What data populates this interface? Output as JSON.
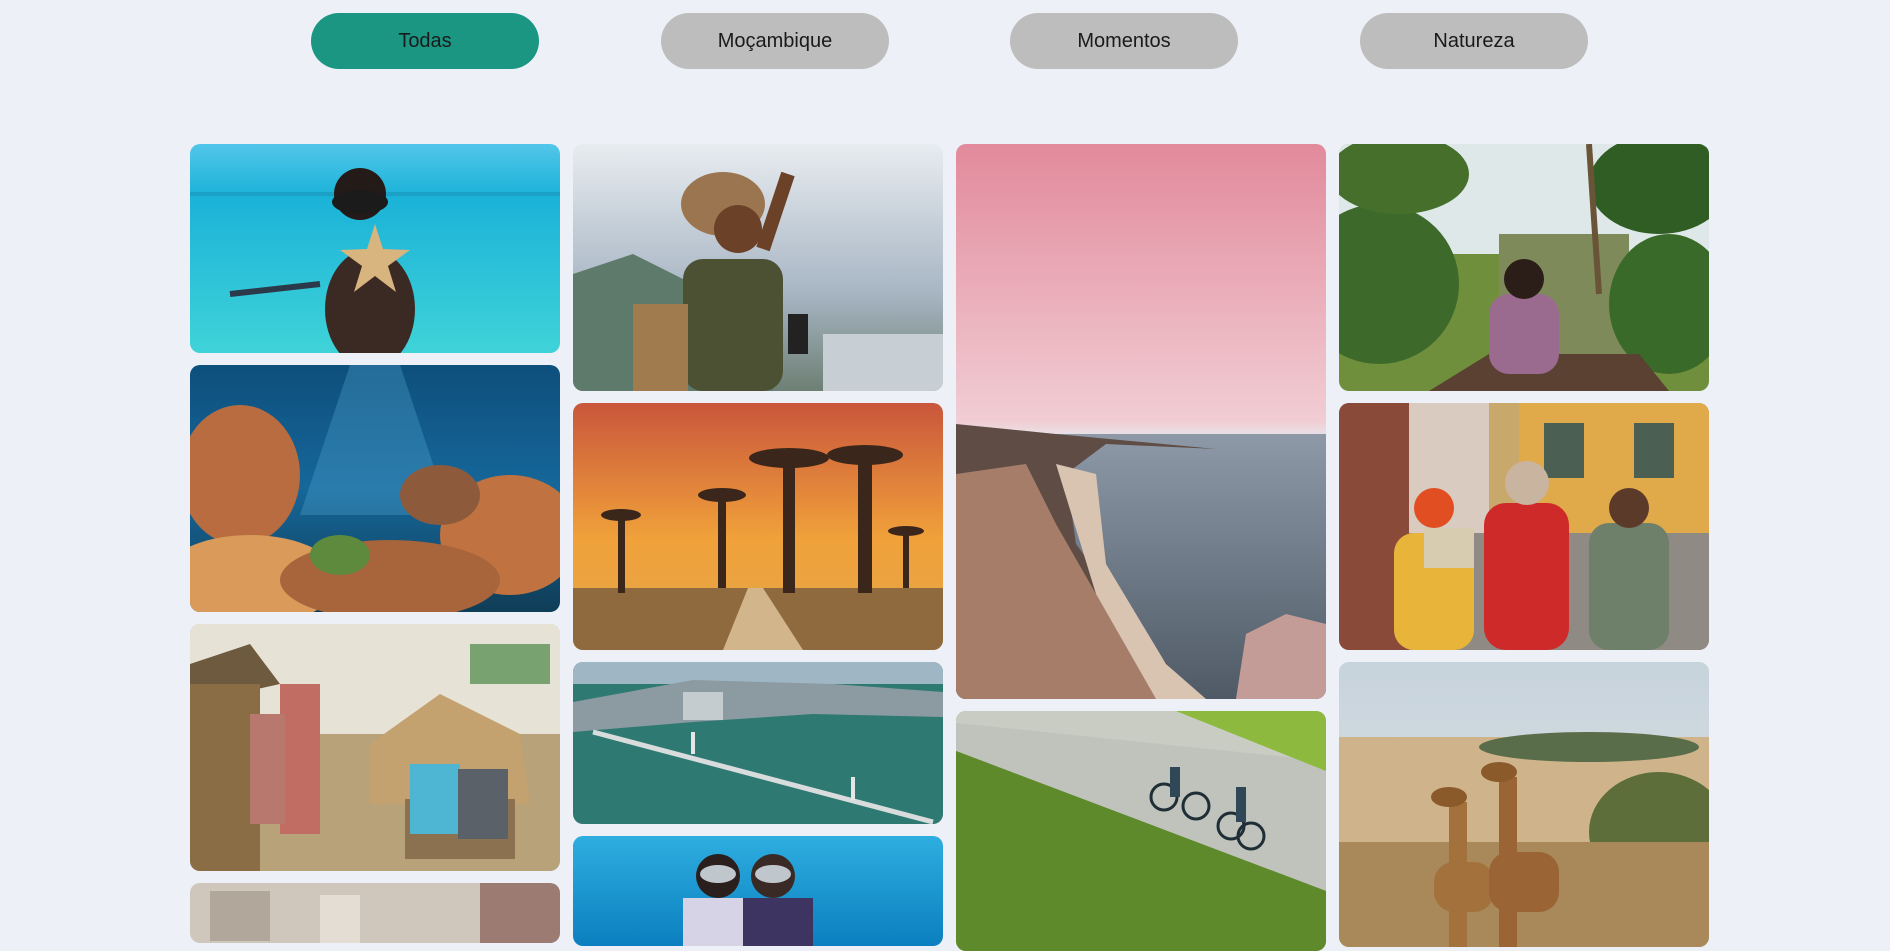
{
  "filters": [
    {
      "label": "Todas",
      "active": true
    },
    {
      "label": "Moçambique",
      "active": false
    },
    {
      "label": "Momentos",
      "active": false
    },
    {
      "label": "Natureza",
      "active": false
    }
  ],
  "colors": {
    "background": "#edf1f7",
    "active_filter": "#1a9682",
    "inactive_filter": "#bdbdbd"
  },
  "gallery": {
    "photos": [
      {
        "subject": "boy-snorkeling-with-starfish"
      },
      {
        "subject": "coral-reef-underwater"
      },
      {
        "subject": "village-family-huts"
      },
      {
        "subject": "city-building-partial"
      },
      {
        "subject": "woman-traveler-hat-binoculars"
      },
      {
        "subject": "baobab-avenue-sunset"
      },
      {
        "subject": "aerial-bridge-city-bay"
      },
      {
        "subject": "scuba-divers"
      },
      {
        "subject": "pink-sky-coastal-cliffs"
      },
      {
        "subject": "cyclists-road-vineyard"
      },
      {
        "subject": "woman-canoe-palm-river"
      },
      {
        "subject": "friends-bicycles-map-street"
      },
      {
        "subject": "giraffes-savanna"
      }
    ]
  }
}
